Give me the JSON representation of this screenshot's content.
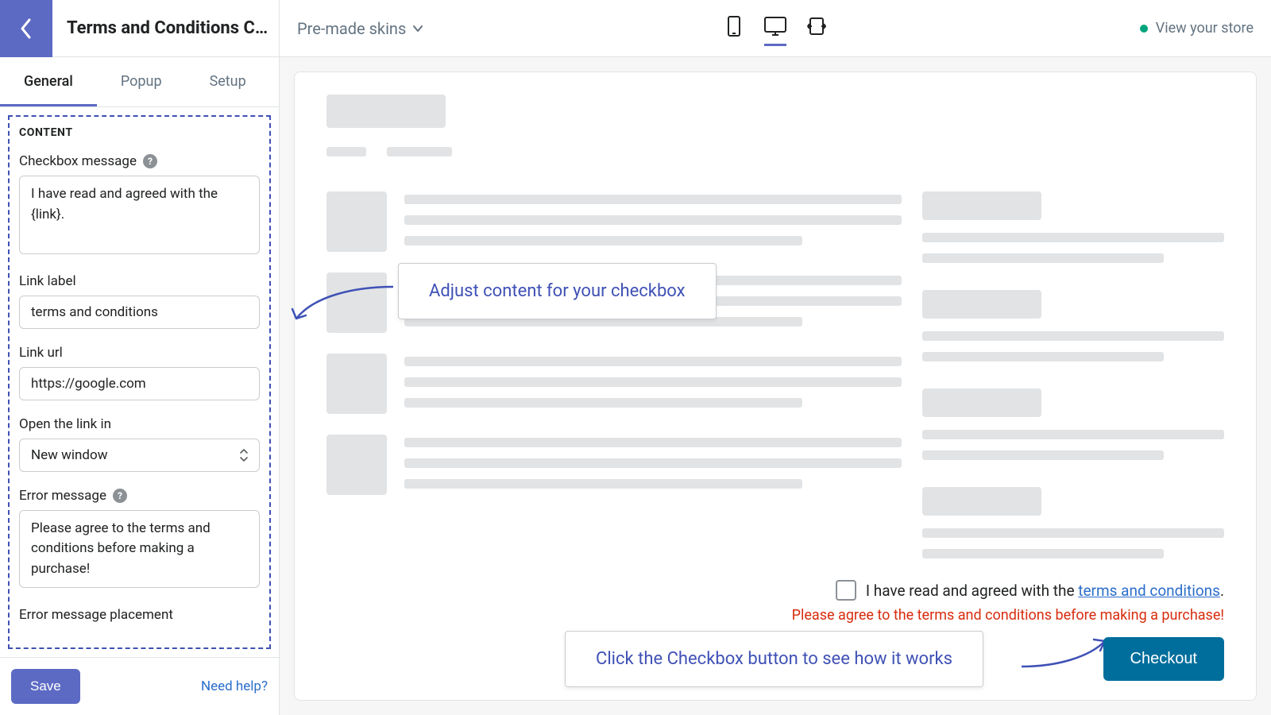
{
  "sidebar": {
    "panel_title": "Terms and Conditions Ch…",
    "tabs": {
      "general": "General",
      "popup": "Popup",
      "setup": "Setup"
    },
    "section_label": "CONTENT",
    "checkbox_message_label": "Checkbox message",
    "checkbox_message_value": "I have read and agreed with the {link}.",
    "link_label_label": "Link label",
    "link_label_value": "terms and conditions",
    "link_url_label": "Link url",
    "link_url_value": "https://google.com",
    "open_link_label": "Open the link in",
    "open_link_value": "New window",
    "error_message_label": "Error message",
    "error_message_value": "Please agree to the terms and conditions before making a purchase!",
    "error_placement_label": "Error message placement",
    "save_label": "Save",
    "need_help_label": "Need help?"
  },
  "topbar": {
    "skins_label": "Pre-made skins",
    "view_store_label": "View your store"
  },
  "preview": {
    "callout_adjust": "Adjust content for your checkbox",
    "callout_click": "Click the Checkbox button to see how it works",
    "consent_prefix": "I have read and agreed with the ",
    "consent_link": "terms and conditions",
    "consent_suffix": ".",
    "error_text": "Please agree to the terms and conditions before making a purchase!",
    "checkout_label": "Checkout"
  },
  "colors": {
    "accent": "#5c6ac4",
    "action": "#006e9c",
    "error": "#d72c0d",
    "link": "#2c6ecb",
    "success_dot": "#00a47c"
  }
}
